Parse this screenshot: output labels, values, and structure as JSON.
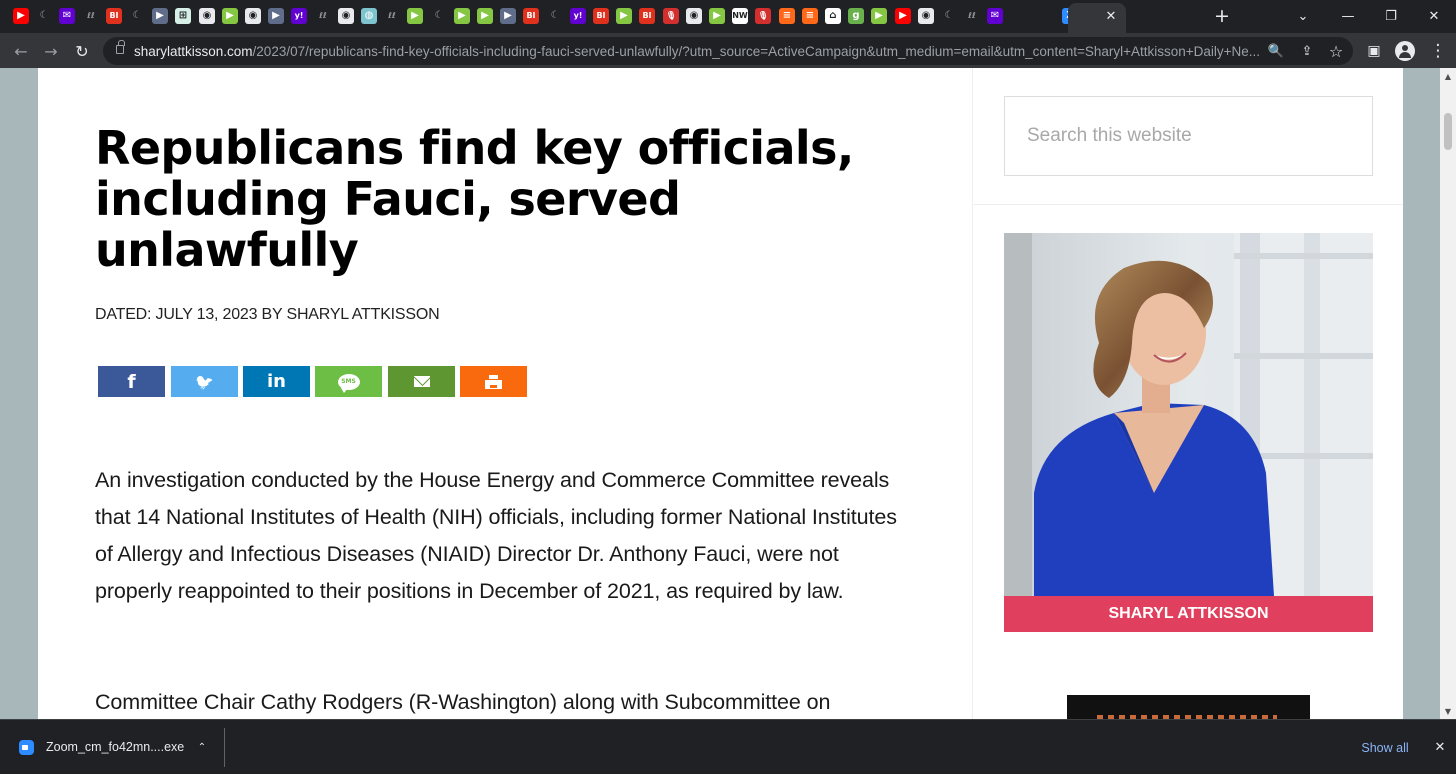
{
  "browser": {
    "tab_favicons": [
      {
        "icon": "youtube-icon",
        "color": "#ff0000",
        "glyph": "▶"
      },
      {
        "icon": "crescent-icon",
        "color": "#202124",
        "glyph": "☾"
      },
      {
        "icon": "yahoo-mail-icon",
        "color": "#6001d2",
        "glyph": "✉"
      },
      {
        "icon": "ll-icon",
        "color": "#202124",
        "glyph": "ℓℓ"
      },
      {
        "icon": "bi-icon",
        "color": "#e0301e",
        "glyph": "BI"
      },
      {
        "icon": "crescent-icon",
        "color": "#202124",
        "glyph": "☾"
      },
      {
        "icon": "bookmark-arrow-icon",
        "color": "#5f6c8a",
        "glyph": "▶"
      },
      {
        "icon": "grid-icon",
        "color": "#d7f0e7",
        "glyph": "⊞"
      },
      {
        "icon": "globe-icon",
        "color": "#e8eaed",
        "glyph": "◉"
      },
      {
        "icon": "rumble-icon",
        "color": "#85c742",
        "glyph": "▶"
      },
      {
        "icon": "globe-icon",
        "color": "#e8eaed",
        "glyph": "◉"
      },
      {
        "icon": "bookmark-arrow-icon",
        "color": "#5f6c8a",
        "glyph": "▶"
      },
      {
        "icon": "yahoo-icon",
        "color": "#6001d2",
        "glyph": "y!"
      },
      {
        "icon": "ll-icon",
        "color": "#202124",
        "glyph": "ℓℓ"
      },
      {
        "icon": "globe-icon",
        "color": "#e8eaed",
        "glyph": "◉"
      },
      {
        "icon": "earth-icon",
        "color": "#7ec4cf",
        "glyph": "◍"
      },
      {
        "icon": "ll-icon",
        "color": "#202124",
        "glyph": "ℓℓ"
      },
      {
        "icon": "rumble-icon",
        "color": "#85c742",
        "glyph": "▶"
      },
      {
        "icon": "crescent-icon",
        "color": "#202124",
        "glyph": "☾"
      },
      {
        "icon": "rumble-icon",
        "color": "#85c742",
        "glyph": "▶"
      },
      {
        "icon": "rumble-icon",
        "color": "#85c742",
        "glyph": "▶"
      },
      {
        "icon": "bookmark-arrow-icon",
        "color": "#5f6c8a",
        "glyph": "▶"
      },
      {
        "icon": "bi-icon",
        "color": "#e0301e",
        "glyph": "BI"
      },
      {
        "icon": "crescent-icon",
        "color": "#202124",
        "glyph": "☾"
      },
      {
        "icon": "yahoo-icon",
        "color": "#6001d2",
        "glyph": "y!"
      },
      {
        "icon": "bi-icon",
        "color": "#e0301e",
        "glyph": "BI"
      },
      {
        "icon": "rumble-icon",
        "color": "#85c742",
        "glyph": "▶"
      },
      {
        "icon": "bi-icon",
        "color": "#e0301e",
        "glyph": "BI"
      },
      {
        "icon": "podcast-icon",
        "color": "#d32f2f",
        "glyph": "🎙"
      },
      {
        "icon": "globe-icon",
        "color": "#e8eaed",
        "glyph": "◉"
      },
      {
        "icon": "rumble-icon",
        "color": "#85c742",
        "glyph": "▶"
      },
      {
        "icon": "news-icon",
        "color": "#ffffff",
        "glyph": "NW"
      },
      {
        "icon": "podcast-icon",
        "color": "#d32f2f",
        "glyph": "🎙"
      },
      {
        "icon": "substack-icon",
        "color": "#ff6719",
        "glyph": "≡"
      },
      {
        "icon": "substack-icon",
        "color": "#ff6719",
        "glyph": "≡"
      },
      {
        "icon": "building-icon",
        "color": "#ffffff",
        "glyph": "⌂"
      },
      {
        "icon": "g-icon",
        "color": "#6ab04c",
        "glyph": "g"
      },
      {
        "icon": "rumble-icon",
        "color": "#85c742",
        "glyph": "▶"
      },
      {
        "icon": "youtube-icon",
        "color": "#ff0000",
        "glyph": "▶"
      },
      {
        "icon": "globe-icon",
        "color": "#e8eaed",
        "glyph": "◉"
      },
      {
        "icon": "crescent-icon",
        "color": "#202124",
        "glyph": "☾"
      },
      {
        "icon": "ll-icon",
        "color": "#202124",
        "glyph": "ℓℓ"
      },
      {
        "icon": "yahoo-mail-icon",
        "color": "#6001d2",
        "glyph": "✉"
      },
      {
        "icon": "active-tab-icon",
        "color": "#35363a",
        "glyph": ""
      },
      {
        "icon": "zoom-icon",
        "color": "#2d8cff",
        "glyph": "Z"
      },
      {
        "icon": "substack-icon",
        "color": "#ff6719",
        "glyph": "≡"
      },
      {
        "icon": "ll-icon",
        "color": "#202124",
        "glyph": "ℓℓ"
      }
    ],
    "tab_close_glyph": "✕",
    "new_tab_glyph": "+",
    "window_controls": {
      "tab_search": "⌄",
      "minimize": "—",
      "restore": "❐",
      "close": "✕"
    },
    "nav": {
      "back": "←",
      "forward": "→",
      "reload": "↻"
    },
    "url_host": "sharylattkisson.com",
    "url_path": "/2023/07/republicans-find-key-officials-including-fauci-served-unlawfully/?utm_source=ActiveCampaign&utm_medium=email&utm_content=Sharyl+Attkisson+Daily+Ne...",
    "omnibox_icons": {
      "zoom": "🔍",
      "share": "⇪",
      "bookmark": "☆"
    },
    "toolbar_icons": {
      "side_panel": "▣",
      "menu": "⋮"
    }
  },
  "article": {
    "title": "Republicans find key officials, including Fauci, served unlawfully",
    "byline_prefix": "Dated: ",
    "date": "July 13, 2023",
    "byline_by": " by ",
    "author": "Sharyl Attkisson",
    "share_buttons": [
      {
        "name": "facebook",
        "glyph": "f"
      },
      {
        "name": "twitter",
        "glyph": "🐦"
      },
      {
        "name": "linkedin",
        "glyph": "in"
      },
      {
        "name": "sms",
        "glyph": "SMS"
      },
      {
        "name": "email",
        "glyph": ""
      },
      {
        "name": "print",
        "glyph": ""
      }
    ],
    "paragraphs": [
      "An investigation conducted by the House Energy and Commerce Committee reveals that 14 National Institutes of Health (NIH) officials, including former National Institutes of Allergy and Infectious Diseases (NIAID) Director Dr. Anthony Fauci, were not properly reappointed to their positions in December of 2021, as required by law.",
      "Committee Chair Cathy Rodgers (R-Washington) along with Subcommittee on"
    ]
  },
  "sidebar": {
    "search_placeholder": "Search this website",
    "profile_name": "Sharyl Attkisson"
  },
  "download_bar": {
    "file_name": "Zoom_cm_fo42mn....exe",
    "caret": "⌃",
    "show_all": "Show all",
    "close": "✕"
  },
  "colors": {
    "accent_band": "#e0405d",
    "facebook": "#3b5998",
    "twitter": "#55acee",
    "linkedin": "#0077b5",
    "sms": "#6cbe45",
    "email": "#5e9732",
    "print": "#f96a0e"
  }
}
